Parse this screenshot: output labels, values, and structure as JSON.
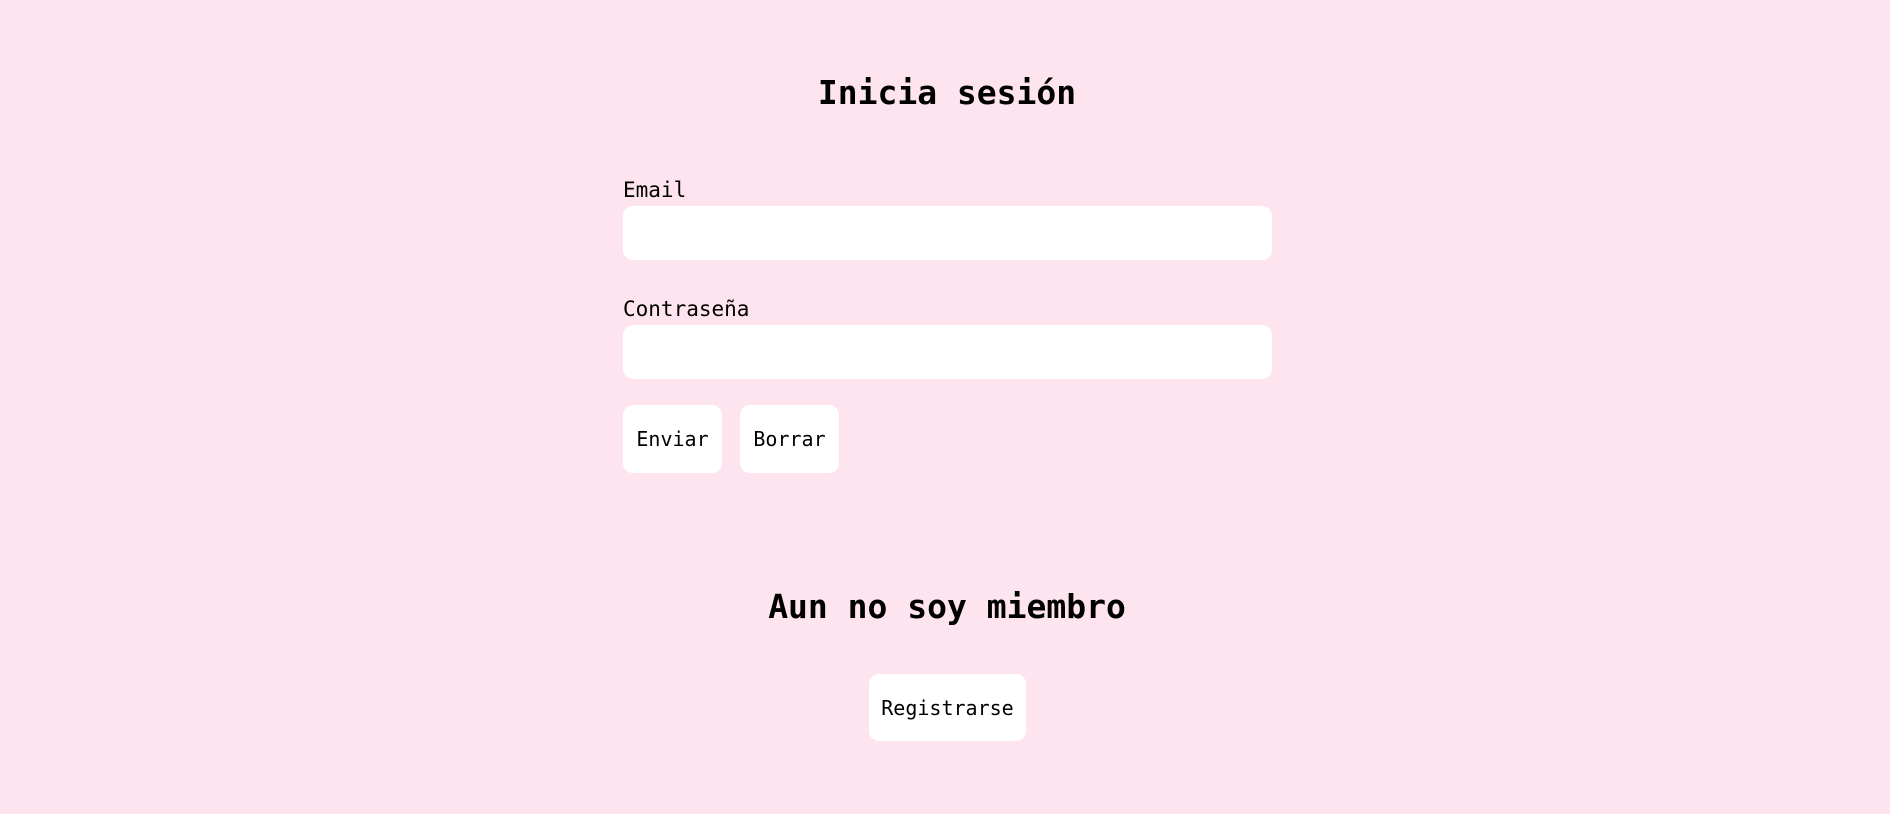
{
  "login": {
    "title": "Inicia sesión",
    "email_label": "Email",
    "email_value": "",
    "password_label": "Contraseña",
    "password_value": "",
    "submit_label": "Enviar",
    "clear_label": "Borrar"
  },
  "signup": {
    "title": "Aun no soy miembro",
    "register_label": "Registrarse"
  },
  "colors": {
    "background": "#fde4ee",
    "field_background": "#ffffff",
    "text": "#000000"
  }
}
